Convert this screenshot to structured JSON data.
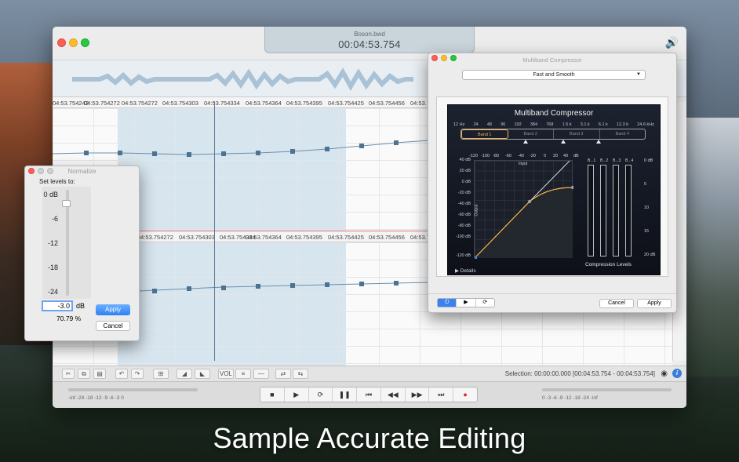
{
  "caption": "Sample Accurate Editing",
  "main_window": {
    "file_name": "Boson.bwd",
    "time_display": "00:04:53.754",
    "speaker_icon": "speaker-icon",
    "track1_ruler": [
      "04:53.754242",
      "04:53.754272",
      "04:53.754272",
      "04:53.754303",
      "04:53.754334",
      "04:53.754364",
      "04:53.754395",
      "04:53.754425",
      "04:53.754456",
      "04:53.754486"
    ],
    "track2_ruler": [
      "04:53.754272",
      "04:53.754303",
      "04:53.754334",
      "04:53.754364",
      "04:53.754395",
      "04:53.754425",
      "04:53.754456",
      "04:53.754486"
    ],
    "toolbar": {
      "vol_label": "VOL",
      "selection_info": "Selection: 00:00:00.000 [00:04:53.754 - 00:04:53.754]",
      "info_label": "i"
    },
    "transport": {
      "buttons": [
        "■",
        "▶",
        "⟳",
        "❚❚",
        "⏮",
        "◀◀",
        "▶▶",
        "⏭",
        "●"
      ],
      "left_scale": "-inf      -24      -18      -12   -9   -6   -3   0",
      "right_scale": "0   -3   -6   -9   -12      -18      -24      -inf"
    }
  },
  "normalize": {
    "title": "Normalize",
    "set_levels_label": "Set levels to:",
    "ticks": [
      "0 dB",
      "-6",
      "-12",
      "-18",
      "-24"
    ],
    "value": "-3.0",
    "unit": "dB",
    "percent": "70.79  %",
    "apply": "Apply",
    "cancel": "Cancel",
    "level_fraction": 0.125
  },
  "compressor": {
    "window_title": "Multiband Compressor",
    "preset": "Fast and Smooth",
    "plugin_title": "Multiband Compressor",
    "freqs": [
      "12 Hz",
      "24",
      "48",
      "96",
      "192",
      "384",
      "768",
      "1.5 k",
      "3.1 k",
      "6.1 k",
      "12.3 k",
      "24.6 kHz"
    ],
    "bands": [
      "Band 1",
      "Band 2",
      "Band 3",
      "Band 4"
    ],
    "active_band": "Band 1",
    "x_ticks": [
      "-120",
      "-100",
      "-80",
      "-60",
      "-40",
      "-20",
      "0",
      "20",
      "40",
      "dB"
    ],
    "y_ticks": [
      "40 dB",
      "20 dB",
      "0 dB",
      "-20 dB",
      "-40 dB",
      "-60 dB",
      "-80 dB",
      "-100 dB",
      "-120 dB"
    ],
    "input_label": "Input",
    "output_label": "Output",
    "meter_labels": [
      "B...1",
      "B...2",
      "B...3",
      "B...4"
    ],
    "right_scale": [
      "0 dB",
      "5",
      "10",
      "15",
      "20 dB"
    ],
    "compression_levels_label": "Compression Levels",
    "details_label": "▶ Details",
    "seg_buttons": [
      "⏻",
      "▶",
      "⟳"
    ],
    "cancel": "Cancel",
    "apply": "Apply",
    "curve_color": "#f6b34a"
  }
}
